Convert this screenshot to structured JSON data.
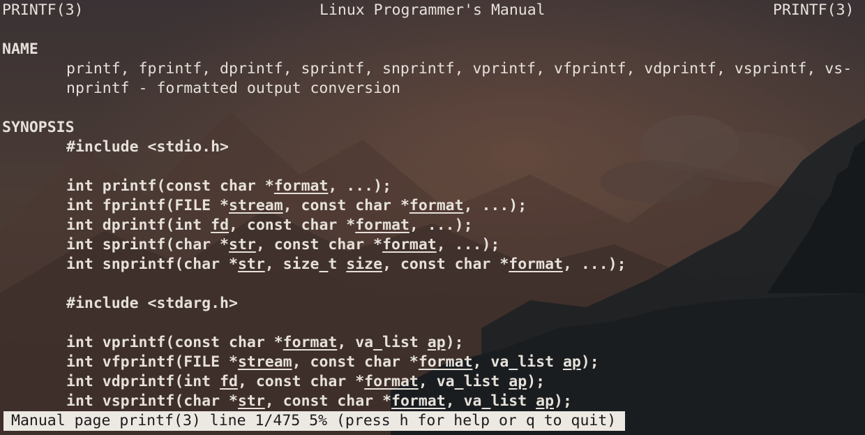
{
  "header": {
    "left": "PRINTF(3)",
    "center": "Linux Programmer's Manual",
    "right": "PRINTF(3)"
  },
  "name_section": {
    "title": "NAME",
    "line1": "printf, fprintf, dprintf, sprintf, snprintf, vprintf, vfprintf, vdprintf, vsprintf, vs-",
    "line2": "nprintf - formatted output conversion"
  },
  "synopsis_section": {
    "title": "SYNOPSIS",
    "include1": "#include <stdio.h>",
    "include2": "#include <stdarg.h>",
    "p": {
      "int": "int ",
      "printf_open": "printf(const char *",
      "fprintf_open": "fprintf(FILE *",
      "dprintf_open": "dprintf(int ",
      "sprintf_open": "sprintf(char *",
      "snprintf_open": "snprintf(char *",
      "vprintf_open": "vprintf(const char *",
      "vfprintf_open": "vfprintf(FILE *",
      "vdprintf_open": "vdprintf(int ",
      "vsprintf_open": "vsprintf(char *",
      "const_char": ", const char *",
      "size_t": ", size_t ",
      "va_list": ", va_list ",
      "ellipsis_end": ", ...);",
      "close": ");"
    },
    "params": {
      "format": "format",
      "stream": "stream",
      "fd": "fd",
      "str": "str",
      "size": "size",
      "ap": "ap"
    }
  },
  "status_bar": {
    "text": "Manual page printf(3) line 1/475 5% (press h for help or q to quit)"
  },
  "colors": {
    "text": "#e6e1da",
    "status_bg": "#ece8e2",
    "status_fg": "#1c1b1c"
  }
}
